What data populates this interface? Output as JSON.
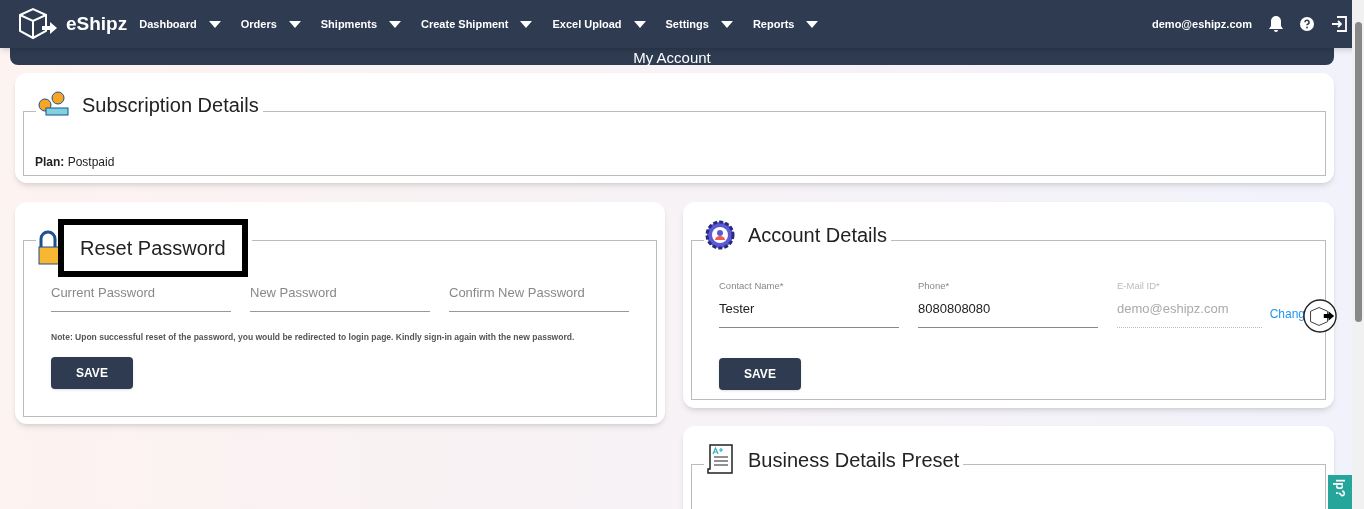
{
  "nav": {
    "brand": "eShipz",
    "items": [
      {
        "label": "Dashboard"
      },
      {
        "label": "Orders"
      },
      {
        "label": "Shipments"
      },
      {
        "label": "Create Shipment"
      },
      {
        "label": "Excel Upload"
      },
      {
        "label": "Settings"
      },
      {
        "label": "Reports"
      }
    ],
    "user": "demo@eshipz.com"
  },
  "page_title": "My Account",
  "subscription": {
    "title": "Subscription Details",
    "plan_label": "Plan:",
    "plan_value": "Postpaid"
  },
  "reset_password": {
    "title": "Reset Password",
    "fields": [
      {
        "placeholder": "Current Password"
      },
      {
        "placeholder": "New Password"
      },
      {
        "placeholder": "Confirm New Password"
      }
    ],
    "note": "Note: Upon successful reset of the password, you would be redirected to login page. Kindly sign-in again with the new password.",
    "button": "SAVE"
  },
  "account": {
    "title": "Account Details",
    "fields": [
      {
        "label": "Contact Name*",
        "value": "Tester",
        "disabled": false
      },
      {
        "label": "Phone*",
        "value": "8080808080",
        "disabled": false
      },
      {
        "label": "E-Mail ID*",
        "value": "demo@eshipz.com",
        "disabled": true
      }
    ],
    "change_link": "Chang",
    "button": "SAVE"
  },
  "business": {
    "title": "Business Details Preset"
  },
  "help_tab": "lp?"
}
